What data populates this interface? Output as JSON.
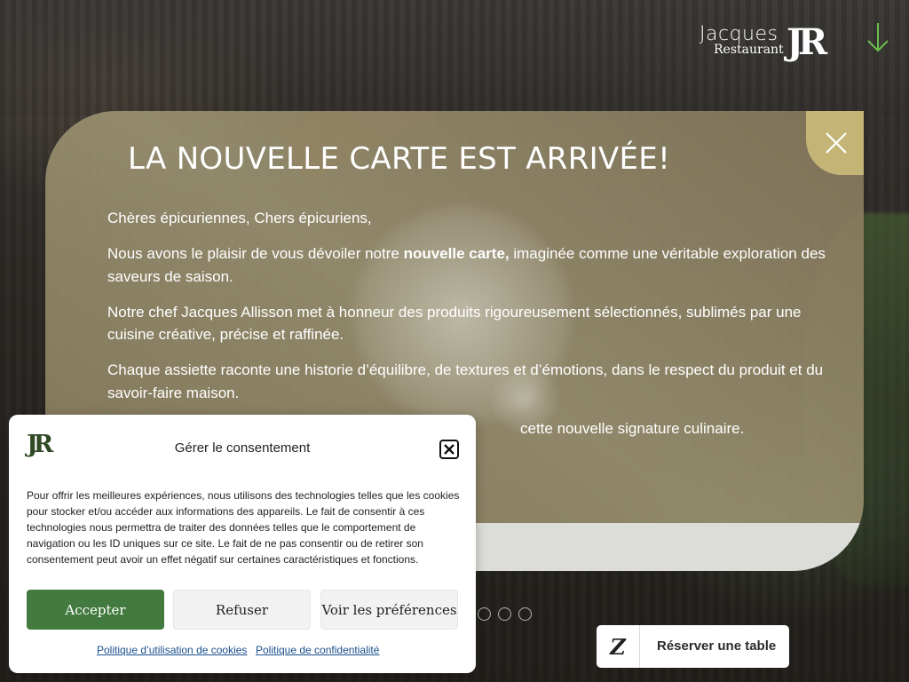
{
  "header": {
    "logo_word": "Jacques",
    "logo_sub": "Restaurant",
    "logo_monogram": "JR"
  },
  "announcement": {
    "title": "LA NOUVELLE CARTE EST ARRIVÉE!",
    "greeting": "Chères épicuriennes, Chers épicuriens,",
    "p1_before": "Nous avons le plaisir de vous dévoiler notre ",
    "p1_bold": "nouvelle carte,",
    "p1_after": " imaginée comme une véritable exploration des saveurs de saison.",
    "p2": "Notre chef Jacques Allisson met à honneur des produits rigoureusement sélectionnés, sublimés par une cuisine créative, précise et raffinée.",
    "p3": "Chaque assiette raconte une historie d’équilibre, de textures et d’émotions, dans le respect du produit et du savoir-faire maison.",
    "p4_visible": "cette nouvelle signature culinaire."
  },
  "reserve": {
    "label": "Réserver une table"
  },
  "consent": {
    "logo_monogram": "JR",
    "title": "Gérer le consentement",
    "text": "Pour offrir les meilleures expériences, nous utilisons des technologies telles que les cookies pour stocker et/ou accéder aux informations des appareils. Le fait de consentir à ces technologies nous permettra de traiter des données telles que le comportement de navigation ou les ID uniques sur ce site. Le fait de ne pas consentir ou de retirer son consentement peut avoir un effet négatif sur certaines caractéristiques et fonctions.",
    "accept_label": "Accepter",
    "refuse_label": "Refuser",
    "prefs_label": "Voir les préférences",
    "cookie_policy_link": "Politique d’utilisation de cookies",
    "privacy_policy_link": "Politique de confidentialité"
  },
  "colors": {
    "accent_green": "#437a3f",
    "close_gold": "#c4b577",
    "arrow_green": "#6abf4b"
  },
  "icons": {
    "close": "close-icon",
    "scroll": "arrow-down-icon",
    "instagram": "instagram-icon",
    "booking": "zenchef-icon"
  }
}
